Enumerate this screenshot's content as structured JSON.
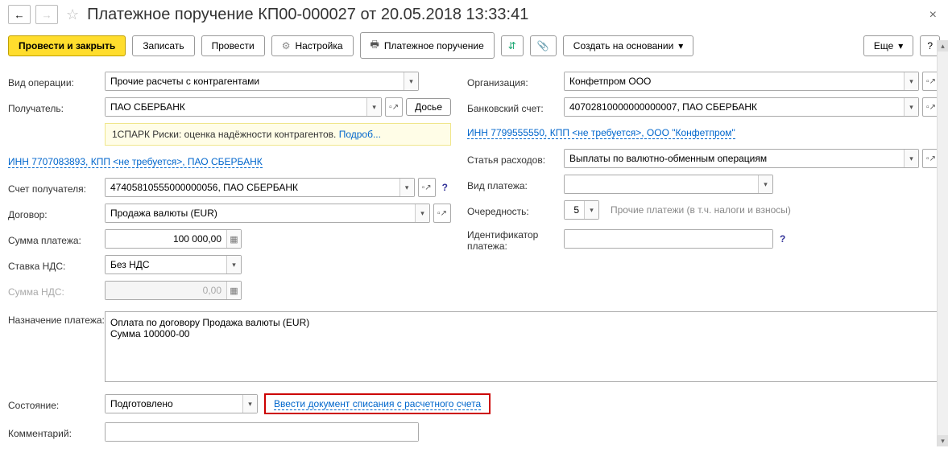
{
  "title": "Платежное поручение КП00-000027 от 20.05.2018 13:33:41",
  "toolbar": {
    "submit_close": "Провести и закрыть",
    "save": "Записать",
    "submit": "Провести",
    "settings": "Настройка",
    "print_doc": "Платежное поручение",
    "create_based": "Создать на основании",
    "more": "Еще"
  },
  "left": {
    "op_type": {
      "label": "Вид операции:",
      "value": "Прочие расчеты с контрагентами"
    },
    "recipient": {
      "label": "Получатель:",
      "value": "ПАО СБЕРБАНК",
      "dossier": "Досье"
    },
    "spark_prefix": "1СПАРК Риски: оценка надёжности контрагентов. ",
    "spark_link": "Подроб...",
    "inn_link": "ИНН 7707083893, КПП <не требуется>, ПАО СБЕРБАНК",
    "recip_account": {
      "label": "Счет получателя:",
      "value": "47405810555000000056, ПАО СБЕРБАНК"
    },
    "contract": {
      "label": "Договор:",
      "value": "Продажа валюты (EUR)"
    },
    "amount": {
      "label": "Сумма платежа:",
      "value": "100 000,00"
    },
    "vat_rate": {
      "label": "Ставка НДС:",
      "value": "Без НДС"
    },
    "vat_sum": {
      "label": "Сумма НДС:",
      "value": "0,00"
    },
    "purpose": {
      "label": "Назначение платежа:",
      "value": "Оплата по договору Продажа валюты (EUR)\nСумма 100000-00"
    }
  },
  "right": {
    "org": {
      "label": "Организация:",
      "value": "Конфетпром ООО"
    },
    "bank_acc": {
      "label": "Банковский счет:",
      "value": "40702810000000000007, ПАО СБЕРБАНК"
    },
    "org_inn_link": "ИНН 7799555550, КПП <не требуется>, ООО \"Конфетпром\"",
    "expense": {
      "label": "Статья расходов:",
      "value": "Выплаты по валютно-обменным операциям"
    },
    "pay_type": {
      "label": "Вид платежа:",
      "value": ""
    },
    "priority": {
      "label": "Очередность:",
      "value": "5",
      "note": "Прочие платежи (в т.ч. налоги и взносы)"
    },
    "pay_id": {
      "label": "Идентификатор платежа:",
      "value": ""
    }
  },
  "bottom": {
    "state": {
      "label": "Состояние:",
      "value": "Подготовлено"
    },
    "enter_doc_link": "Ввести документ списания с расчетного счета",
    "comment": {
      "label": "Комментарий:",
      "value": ""
    }
  }
}
